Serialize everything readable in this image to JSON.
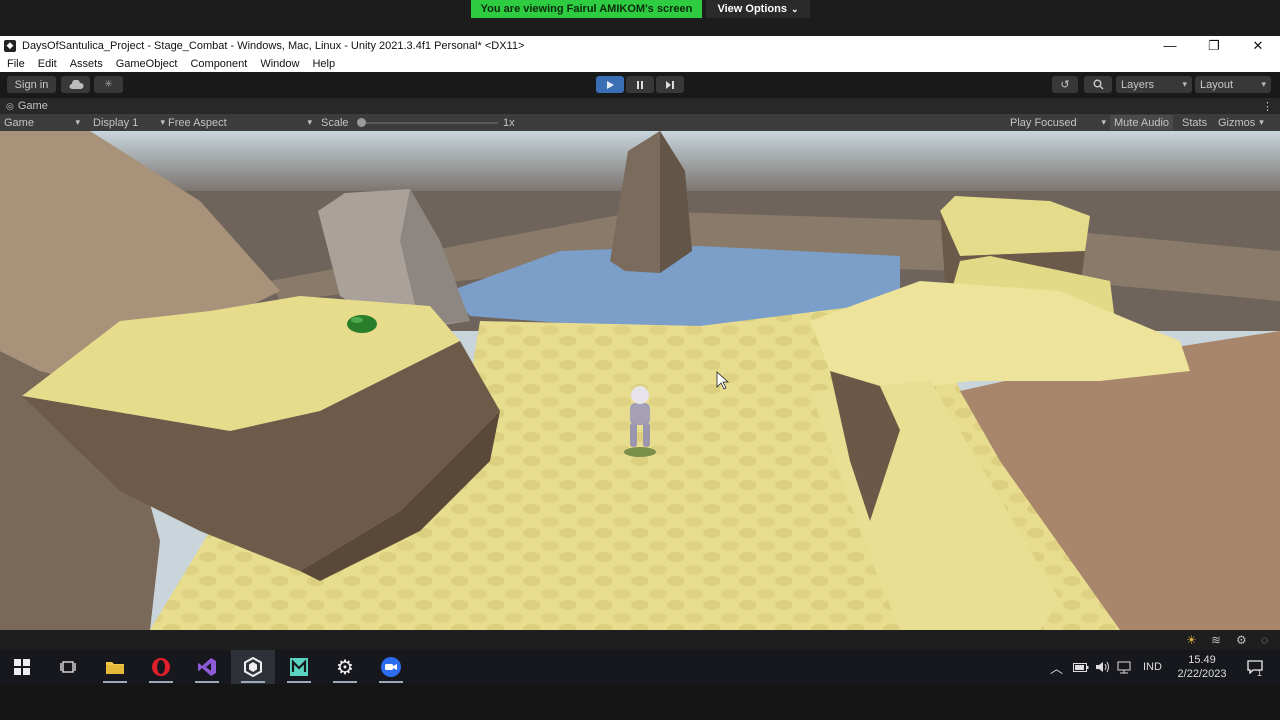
{
  "zoom": {
    "banner_text": "You are viewing Fairul AMIKOM's screen",
    "view_options_label": "View Options",
    "view_options_icon": "chevron-down-icon"
  },
  "window": {
    "title": "DaysOfSantulica_Project - Stage_Combat - Windows, Mac, Linux - Unity 2021.3.4f1 Personal* <DX11>",
    "minimize": "—",
    "restore": "❐",
    "close": "✕"
  },
  "menu": [
    "File",
    "Edit",
    "Assets",
    "GameObject",
    "Component",
    "Window",
    "Help"
  ],
  "toolbar": {
    "sign_in_label": "Sign in",
    "layers_label": "Layers",
    "layout_label": "Layout"
  },
  "game_panel": {
    "tab_label": "Game",
    "mode_label": "Game",
    "display_label": "Display 1",
    "aspect_label": "Free Aspect",
    "scale_label": "Scale",
    "scale_value": "1x",
    "play_focused_label": "Play Focused",
    "mute_audio_label": "Mute Audio",
    "stats_label": "Stats",
    "gizmos_label": "Gizmos"
  },
  "taskbar": {
    "apps": [
      {
        "name": "start",
        "icon": "windows-icon"
      },
      {
        "name": "task-view",
        "icon": "task-view-icon"
      },
      {
        "name": "file-explorer",
        "icon": "folder-icon"
      },
      {
        "name": "opera",
        "icon": "opera-icon"
      },
      {
        "name": "visual-studio",
        "icon": "visual-studio-icon"
      },
      {
        "name": "unity",
        "icon": "unity-icon"
      },
      {
        "name": "m-app",
        "icon": "m-app-icon"
      },
      {
        "name": "settings",
        "icon": "gear-icon"
      },
      {
        "name": "zoom",
        "icon": "zoom-icon"
      }
    ],
    "language": "IND",
    "time": "15.49",
    "date": "2/22/2023",
    "notification_count": "1"
  },
  "colors": {
    "unity_dark": "#191919",
    "play_accent": "#3b6fb5",
    "zoom_green": "#2ecc40",
    "sand": "#e6dc8c",
    "water": "#7b9fc9",
    "rock": "#8d7b66"
  }
}
